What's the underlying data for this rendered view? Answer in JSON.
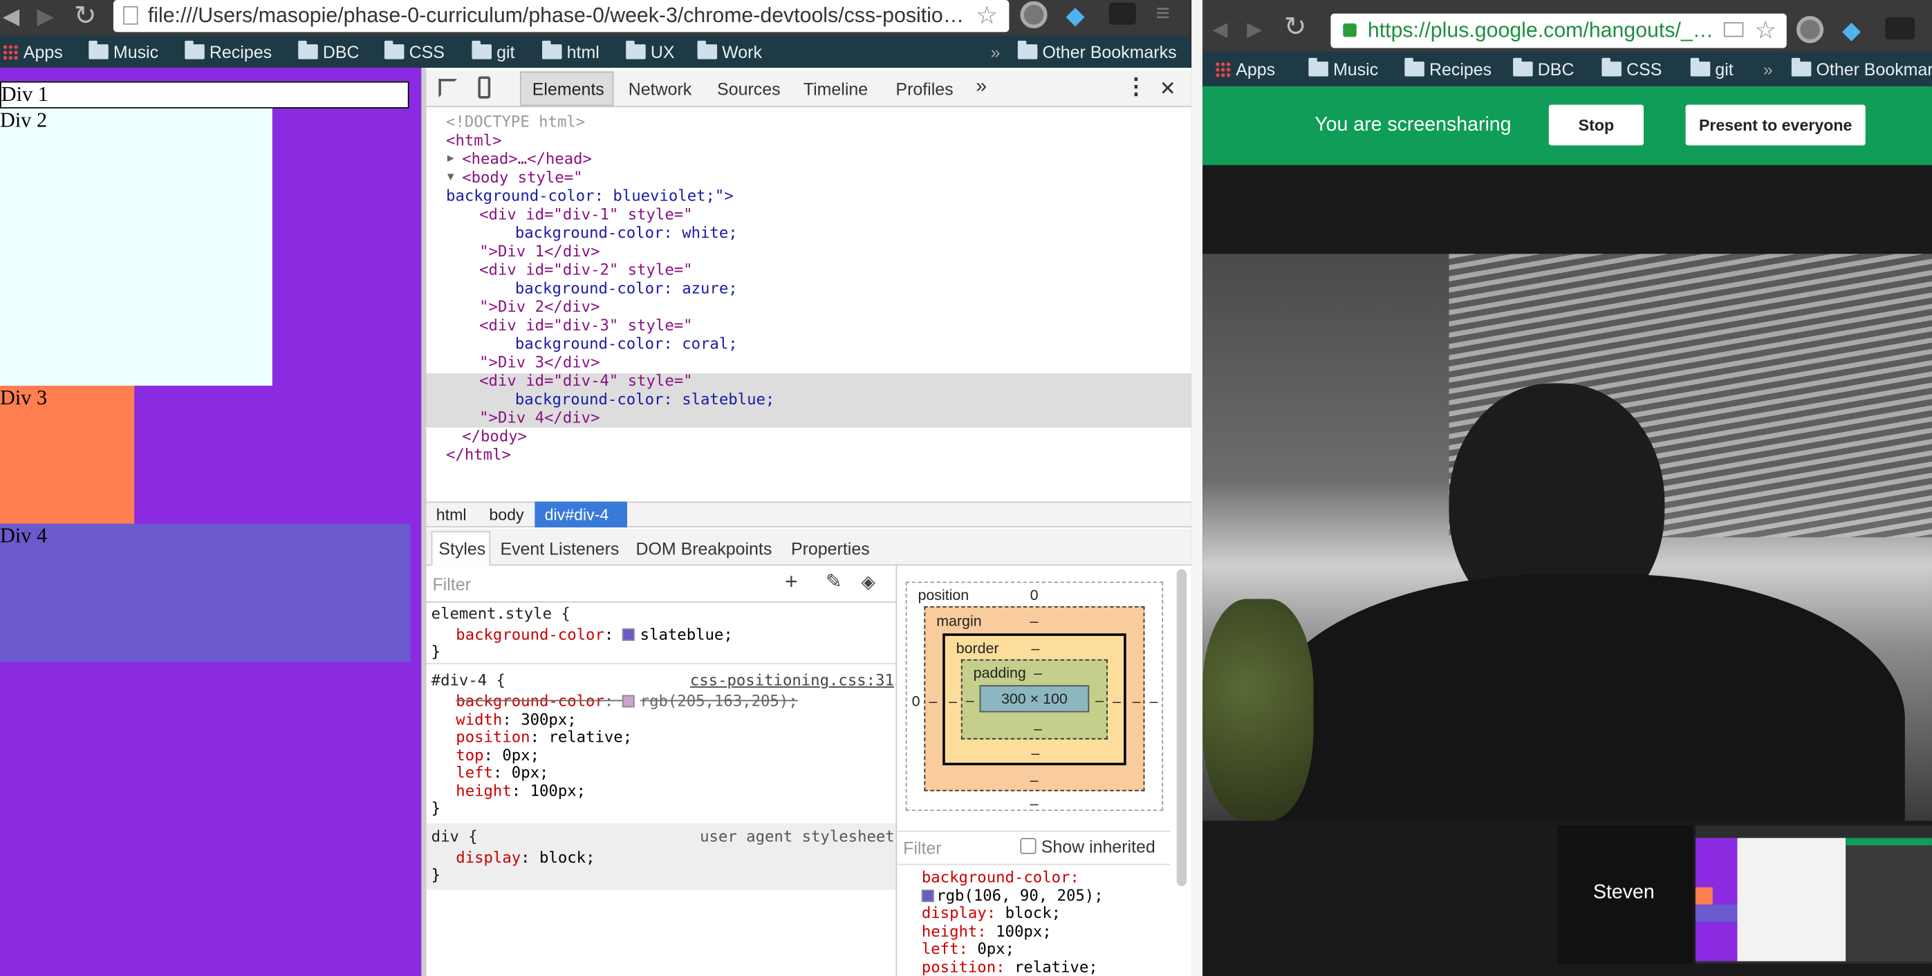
{
  "left_window": {
    "url": "file:///Users/masopie/phase-0-curriculum/phase-0/week-3/chrome-devtools/css-positio…",
    "bookmarks": [
      "Apps",
      "Music",
      "Recipes",
      "DBC",
      "CSS",
      "git",
      "html",
      "UX",
      "Work"
    ],
    "other_bookmarks": "Other Bookmarks",
    "page": {
      "background": "#8a2be2",
      "divs": [
        {
          "label": "Div 1",
          "color": "#ffffff"
        },
        {
          "label": "Div 2",
          "color": "#f0ffff"
        },
        {
          "label": "Div 3",
          "color": "#ff7f50"
        },
        {
          "label": "Div 4",
          "color": "#6a5acd"
        }
      ]
    },
    "devtools": {
      "tabs": [
        "Elements",
        "Network",
        "Sources",
        "Timeline",
        "Profiles"
      ],
      "more": "»",
      "close": "✕",
      "dom": {
        "doctype": "<!DOCTYPE html>",
        "html_open": "<html>",
        "head": "<head>…</head>",
        "body_open_a": "<body style=\"",
        "body_open_b": "background-color: blueviolet;\">",
        "divs": [
          {
            "open": "<div id=\"div-1\" style=\"",
            "style": "background-color: white;",
            "close": "\">Div 1</div>"
          },
          {
            "open": "<div id=\"div-2\" style=\"",
            "style": "background-color: azure;",
            "close": "\">Div 2</div>"
          },
          {
            "open": "<div id=\"div-3\" style=\"",
            "style": "background-color: coral;",
            "close": "\">Div 3</div>"
          },
          {
            "open": "<div id=\"div-4\" style=\"",
            "style": "background-color: slateblue;",
            "close": "\">Div 4</div>"
          }
        ],
        "body_close": "</body>",
        "html_close": "</html>"
      },
      "breadcrumbs": [
        "html",
        "body",
        "div#div-4"
      ],
      "sub_tabs": [
        "Styles",
        "Event Listeners",
        "DOM Breakpoints",
        "Properties"
      ],
      "filter_placeholder": "Filter",
      "styles": {
        "element_style": {
          "selector": "element.style {",
          "prop": "background-color",
          "value": "slateblue;",
          "swatch": "#6a5acd"
        },
        "rule2": {
          "selector": "#div-4 {",
          "source": "css-positioning.css:31",
          "props": [
            {
              "name": "background-color",
              "value": "rgb(205,163,205);",
              "struck": true,
              "swatch": "#cda3cd"
            },
            {
              "name": "width",
              "value": "300px;"
            },
            {
              "name": "position",
              "value": "relative;"
            },
            {
              "name": "top",
              "value": "0px;"
            },
            {
              "name": "left",
              "value": "0px;"
            },
            {
              "name": "height",
              "value": "100px;"
            }
          ]
        },
        "rule3": {
          "selector": "div {",
          "source": "user agent stylesheet",
          "prop": "display",
          "value": "block;"
        },
        "close_brace": "}"
      },
      "box_model": {
        "position_label": "position",
        "position_value": "0",
        "margin_label": "margin",
        "border_label": "border",
        "padding_label": "padding",
        "content": "300 × 100",
        "dash": "–",
        "left_value": "0"
      },
      "computed": {
        "filter": "Filter",
        "show_inherited": "Show inherited",
        "props": [
          {
            "name": "background-color:",
            "value": ""
          },
          {
            "name": "",
            "value": "rgb(106, 90, 205);",
            "swatch": "#6a5acd"
          },
          {
            "name": "display:",
            "value": "block;"
          },
          {
            "name": "height:",
            "value": "100px;"
          },
          {
            "name": "left:",
            "value": "0px;"
          },
          {
            "name": "position:",
            "value": "relative;"
          }
        ]
      }
    }
  },
  "right_window": {
    "url": "https://plus.google.com/hangouts/_…",
    "bookmarks": [
      "Apps",
      "Music",
      "Recipes",
      "DBC",
      "CSS",
      "git"
    ],
    "other_bookmarks": "Other Bookmar",
    "banner_text": "You are screensharing",
    "stop_label": "Stop",
    "present_label": "Present to everyone",
    "participant_name": "Steven",
    "banner_color": "#0f9d58"
  }
}
